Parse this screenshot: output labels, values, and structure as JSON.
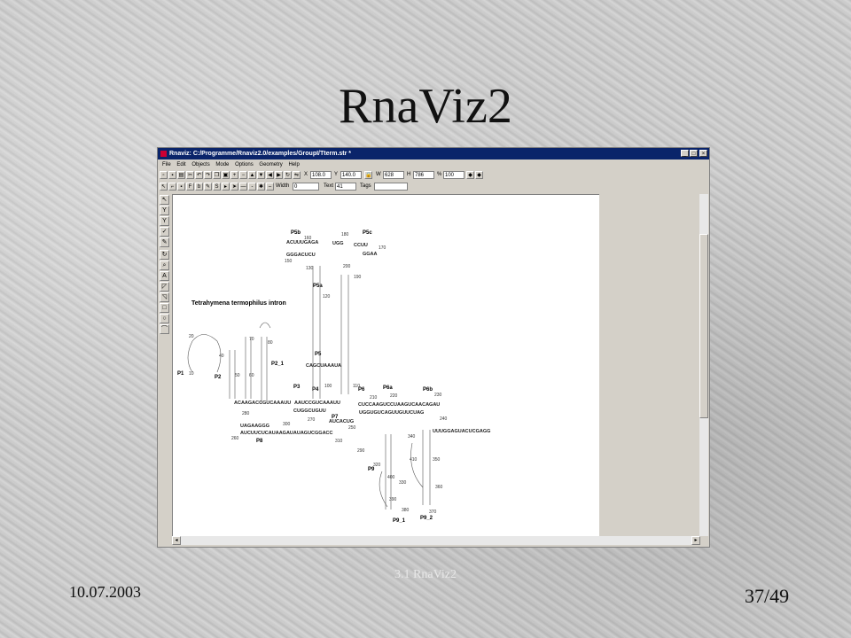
{
  "slide": {
    "title": "RnaViz2",
    "footer_center": "3.1  RnaViz2",
    "date": "10.07.2003",
    "page": "37/49"
  },
  "window": {
    "title": "Rnaviz: C:/Programme/Rnaviz2.0/examples/GroupI/Tterm.str *",
    "buttons": [
      "_",
      "□",
      "×"
    ],
    "menu": [
      "File",
      "Edit",
      "Objects",
      "Mode",
      "Options",
      "Geometry",
      "Help"
    ],
    "fields": {
      "x_label": "X",
      "x": "108.0",
      "y_label": "Y",
      "y": "140.0",
      "w_label": "W",
      "w": "628",
      "h_label": "H",
      "h": "786",
      "pct_label": "%",
      "pct": "100",
      "width_label": "Width",
      "width": "0",
      "text_label": "Text",
      "text": "41",
      "tags_label": "Tags",
      "tags": ""
    }
  },
  "diagram": {
    "caption": "Tetrahymena termophilus intron",
    "domains": [
      "P5b",
      "P5c",
      "P5a",
      "P5",
      "P4",
      "P6",
      "P6a",
      "P6b",
      "P3",
      "P7",
      "P1",
      "P2",
      "P2_1",
      "P8",
      "P9",
      "P9_1",
      "P9_2"
    ],
    "numbers": [
      "160",
      "180",
      "170",
      "150",
      "200",
      "130",
      "190",
      "120",
      "20",
      "10",
      "80",
      "40",
      "70",
      "50",
      "60",
      "100",
      "110",
      "210",
      "220",
      "230",
      "240",
      "250",
      "310",
      "300",
      "260",
      "280",
      "270",
      "290",
      "320",
      "330",
      "340",
      "350",
      "360",
      "370",
      "380",
      "390",
      "400",
      "410"
    ],
    "sequences": [
      "ACUUUGAGA",
      "UGG",
      "CCUU",
      "GGGACUCU",
      "GGAA",
      "CUCCAAGUCCUAAGUCAACAGAU",
      "UGGUGUCAGUUGUUCUAG",
      "AAUCCGUCAAAUU",
      "CUGGCUGUU",
      "ACAAGACCGUCAAAUU",
      "UAGAAGGG",
      "AUCUUCUCAUAAGAUAUAGUCGGACC",
      "UUUGGAGUACUCGAGG",
      "CAGCUAAAUA",
      "AUCACUG"
    ]
  }
}
